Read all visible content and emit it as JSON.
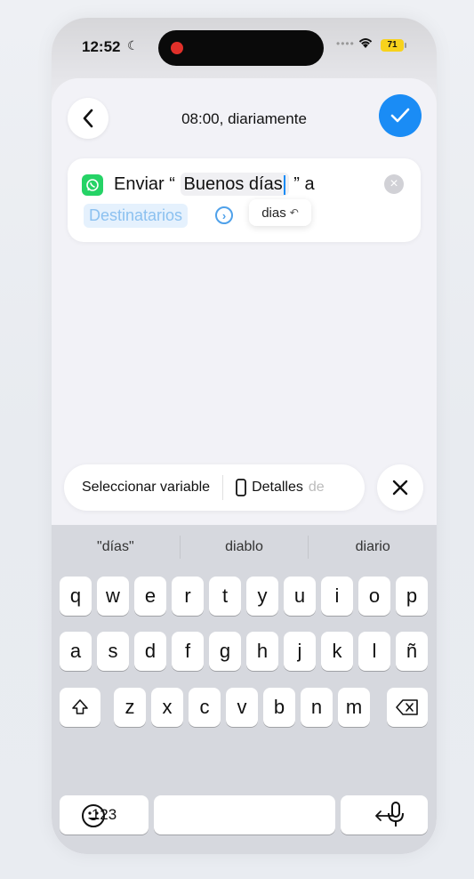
{
  "status": {
    "time": "12:52",
    "battery": "71"
  },
  "header": {
    "title": "08:00, diariamente"
  },
  "action": {
    "verb": "Enviar",
    "quote_open": "“",
    "text_value": "Buenos días",
    "quote_close": "” a",
    "recipients_token": "Destinatarios",
    "autocorrect_suggestion": "dias"
  },
  "toolbar": {
    "select_variable": "Seleccionar variable",
    "details": "Detalles",
    "details_fade": "de"
  },
  "predictions": [
    "\"días\"",
    "diablo",
    "diario"
  ],
  "keyboard": {
    "row1": [
      "q",
      "w",
      "e",
      "r",
      "t",
      "y",
      "u",
      "i",
      "o",
      "p"
    ],
    "row2": [
      "a",
      "s",
      "d",
      "f",
      "g",
      "h",
      "j",
      "k",
      "l",
      "ñ"
    ],
    "row3": [
      "z",
      "x",
      "c",
      "v",
      "b",
      "n",
      "m"
    ],
    "numbers_key": "123"
  }
}
